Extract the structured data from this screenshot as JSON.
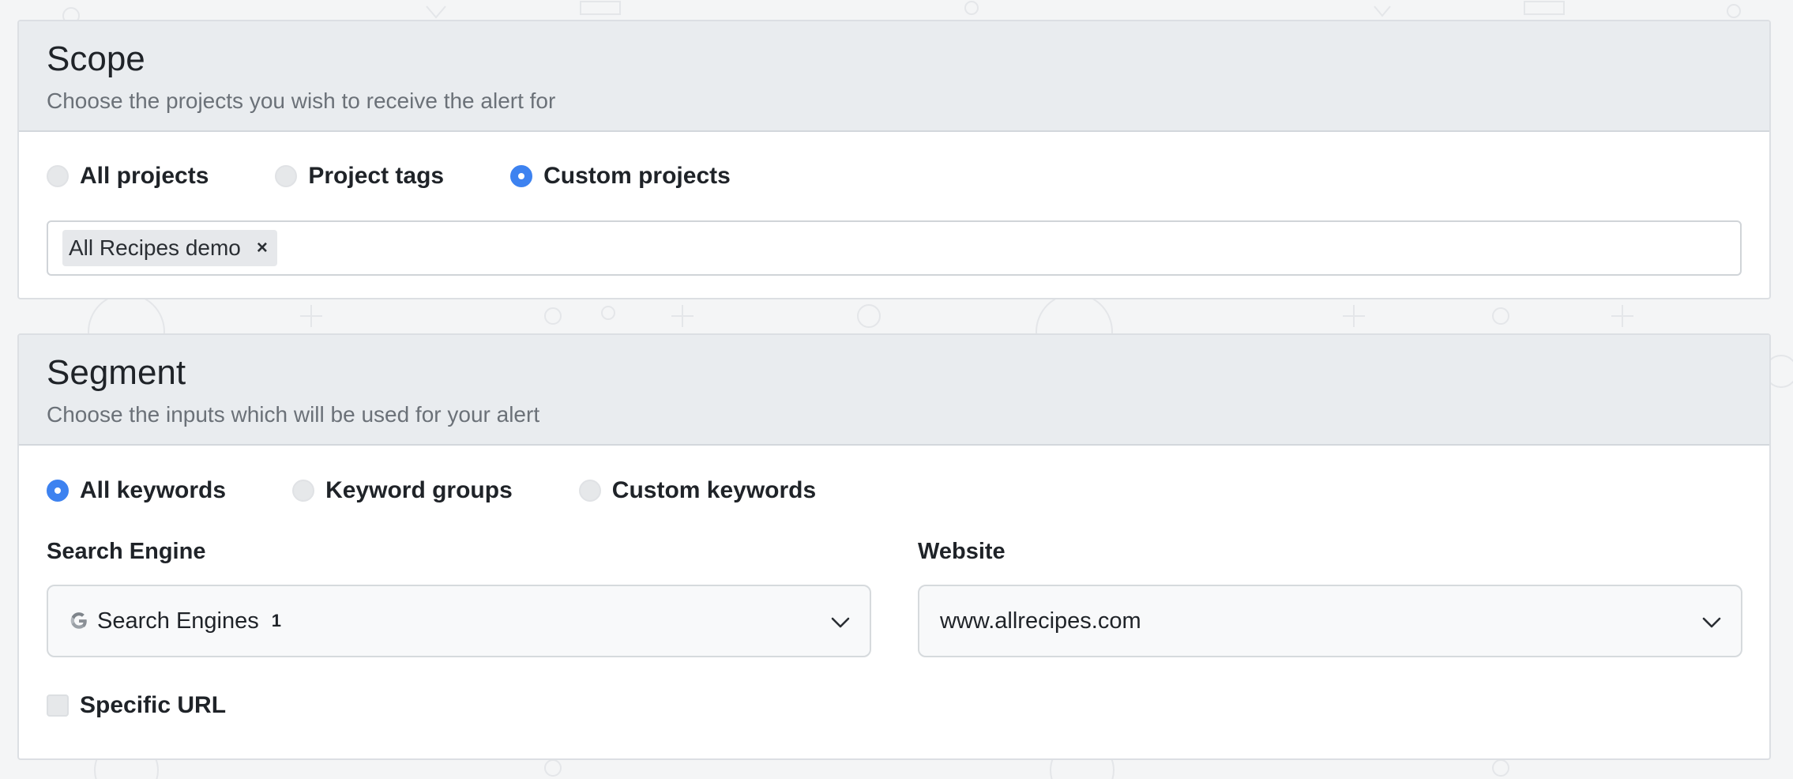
{
  "scope": {
    "title": "Scope",
    "subtitle": "Choose the projects you wish to receive the alert for",
    "options": [
      {
        "label": "All projects",
        "checked": false
      },
      {
        "label": "Project tags",
        "checked": false
      },
      {
        "label": "Custom projects",
        "checked": true
      }
    ],
    "selected_tags": [
      {
        "label": "All Recipes demo",
        "remove_glyph": "×"
      }
    ]
  },
  "segment": {
    "title": "Segment",
    "subtitle": "Choose the inputs which will be used for your alert",
    "options": [
      {
        "label": "All keywords",
        "checked": true
      },
      {
        "label": "Keyword groups",
        "checked": false
      },
      {
        "label": "Custom keywords",
        "checked": false
      }
    ],
    "search_engine": {
      "label": "Search Engine",
      "value": "Search Engines",
      "count": "1",
      "icon": "google-g-icon"
    },
    "website": {
      "label": "Website",
      "value": "www.allrecipes.com"
    },
    "specific_url": {
      "label": "Specific URL",
      "checked": false
    }
  },
  "colors": {
    "accent": "#3d82f0",
    "header_bg": "#e9ecef",
    "page_bg": "#f4f5f6"
  }
}
